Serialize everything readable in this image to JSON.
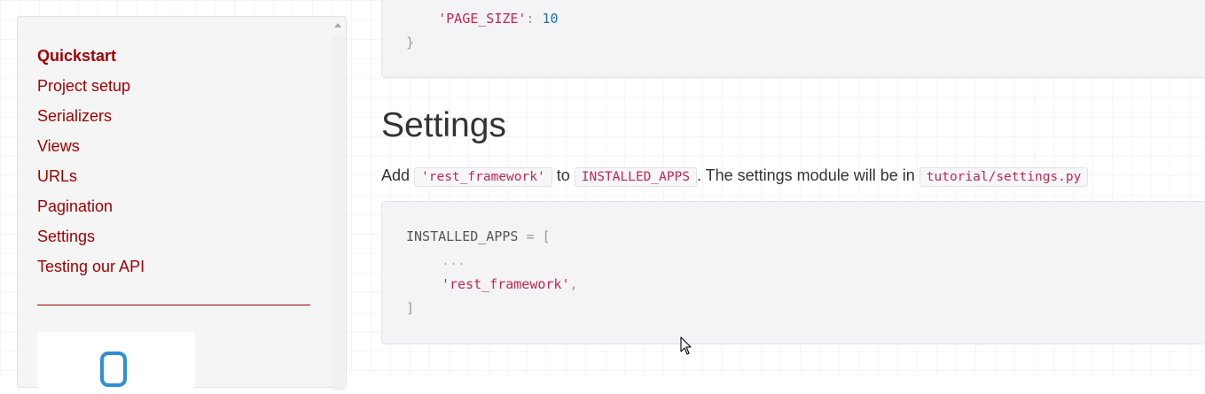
{
  "sidebar": {
    "items": [
      {
        "label": "Quickstart",
        "active": true
      },
      {
        "label": "Project setup",
        "active": false
      },
      {
        "label": "Serializers",
        "active": false
      },
      {
        "label": "Views",
        "active": false
      },
      {
        "label": "URLs",
        "active": false
      },
      {
        "label": "Pagination",
        "active": false
      },
      {
        "label": "Settings",
        "active": false
      },
      {
        "label": "Testing our API",
        "active": false
      }
    ],
    "logo_icon": "logo-icon"
  },
  "code_top": {
    "line1": {
      "key": "'PAGE_SIZE'",
      "colon": ":",
      "value": "10"
    },
    "line2": "}"
  },
  "section": {
    "heading": "Settings",
    "para": {
      "t1": "Add ",
      "c1": "'rest_framework'",
      "t2": " to ",
      "c2": "INSTALLED_APPS",
      "t3": ". The settings module will be in ",
      "c3": "tutorial/settings.py"
    }
  },
  "code_bottom": {
    "line1": {
      "name": "INSTALLED_APPS",
      "op": " = ",
      "open": "["
    },
    "line2": "...",
    "line3": {
      "str": "'rest_framework'",
      "comma": ","
    },
    "line4": "]"
  },
  "colors": {
    "link": "#a30000",
    "string": "#c7254e",
    "number": "#1f6fb0",
    "logo": "#2d8fd6"
  },
  "cursor_icon": "mouse-pointer-icon"
}
